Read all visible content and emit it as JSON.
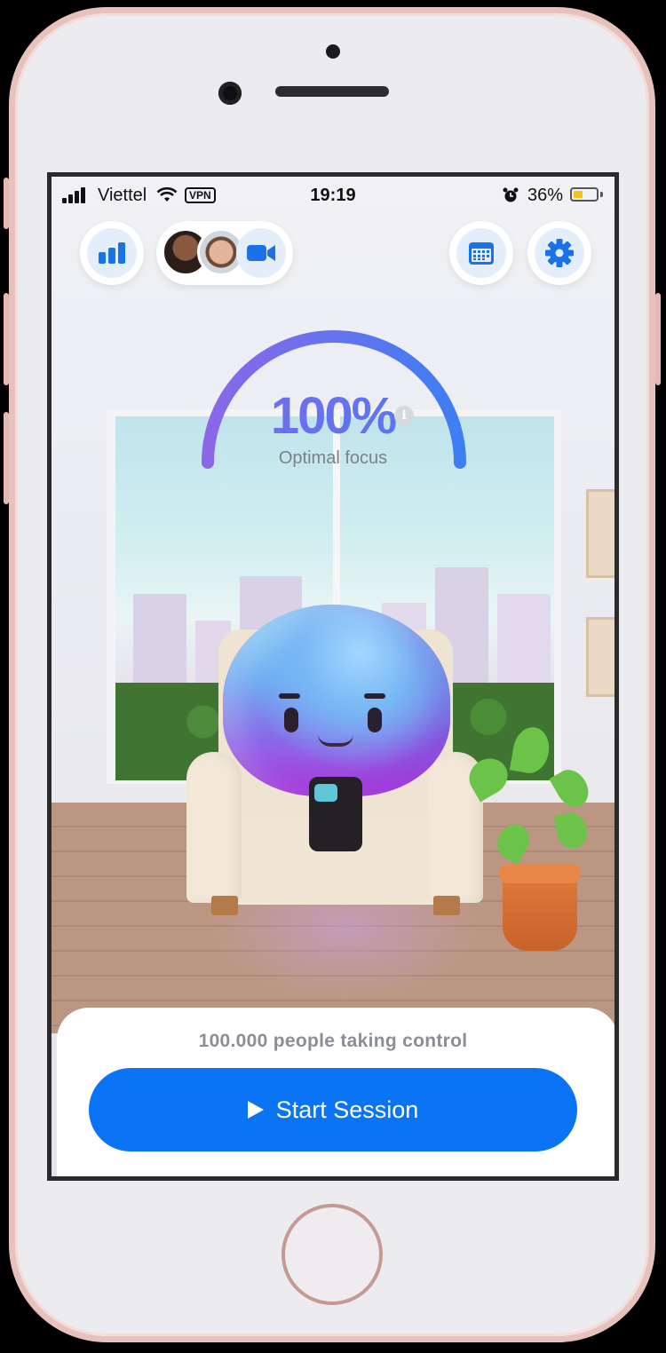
{
  "status_bar": {
    "carrier": "Viettel",
    "vpn": "VPN",
    "time": "19:19",
    "battery_percent": "36%"
  },
  "top_bar": {
    "stats_icon": "bar-chart-icon",
    "video_icon": "video-camera-icon",
    "calendar_icon": "calendar-icon",
    "settings_icon": "gear-icon"
  },
  "focus": {
    "value": "100%",
    "level": 1.0,
    "label": "Optimal focus",
    "info_glyph": "i"
  },
  "bottom": {
    "people_text": "100.000 people taking control",
    "start_label": "Start Session"
  },
  "colors": {
    "accent": "#0b74f5",
    "gauge_start": "#8b67e8",
    "gauge_end": "#3e7ef3"
  }
}
